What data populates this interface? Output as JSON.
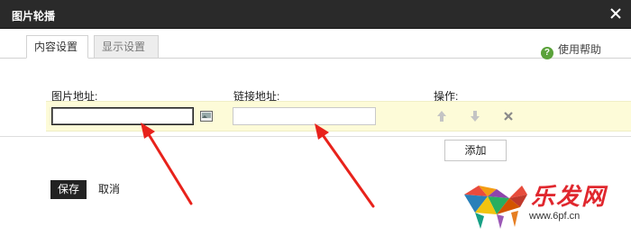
{
  "window": {
    "title": "图片轮播"
  },
  "tabs": [
    {
      "label": "内容设置",
      "active": true
    },
    {
      "label": "显示设置",
      "active": false
    }
  ],
  "help": {
    "label": "使用帮助",
    "icon": "question-circle-icon"
  },
  "form": {
    "image_url_label": "图片地址:",
    "link_url_label": "链接地址:",
    "actions_label": "操作:",
    "image_url_value": "",
    "link_url_value": ""
  },
  "buttons": {
    "add": "添加",
    "save": "保存",
    "cancel": "取消"
  },
  "watermark": {
    "brand": "乐发网",
    "url": "www.6pf.cn"
  },
  "colors": {
    "titlebar": "#2a2a2a",
    "row_highlight": "#fdfbd8",
    "annotation_arrow": "#e8221b",
    "help_green": "#5aa23a"
  }
}
